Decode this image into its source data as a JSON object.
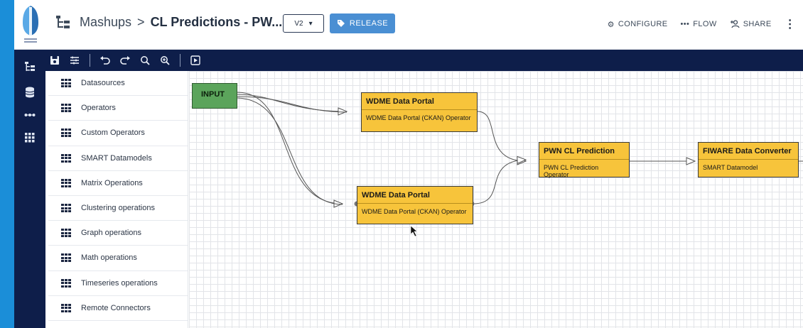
{
  "header": {
    "breadcrumb_root": "Mashups",
    "breadcrumb_sep": ">",
    "breadcrumb_current": "CL Predictions - PW...",
    "version": "V2",
    "release_label": "RELEASE",
    "configure_label": "CONFIGURE",
    "flow_label": "FLOW",
    "share_label": "SHARE"
  },
  "palette": {
    "items": [
      {
        "label": "Datasources"
      },
      {
        "label": "Operators"
      },
      {
        "label": "Custom Operators"
      },
      {
        "label": "SMART Datamodels"
      },
      {
        "label": "Matrix Operations"
      },
      {
        "label": "Clustering operations"
      },
      {
        "label": "Graph operations"
      },
      {
        "label": "Math operations"
      },
      {
        "label": "Timeseries operations"
      },
      {
        "label": "Remote Connectors"
      }
    ]
  },
  "canvas": {
    "input_label": "INPUT",
    "nodes": [
      {
        "title": "WDME Data Portal",
        "subtitle": "WDME Data Portal (CKAN) Operator"
      },
      {
        "title": "WDME Data Portal",
        "subtitle": "WDME Data Portal (CKAN) Operator"
      },
      {
        "title": "PWN CL Prediction",
        "subtitle": "PWN CL Prediction Operator"
      },
      {
        "title": "FIWARE Data Converter",
        "subtitle": "SMART Datamodel"
      }
    ]
  },
  "colors": {
    "nav_bg": "#0e1e4a",
    "accent": "#4a8fd3",
    "node_fill": "#f7c43b",
    "input_fill": "#5ba45b"
  }
}
